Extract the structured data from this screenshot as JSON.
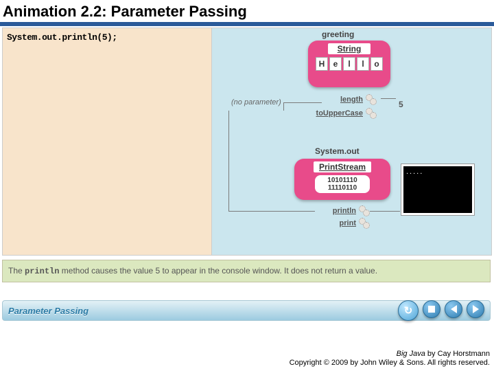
{
  "title": "Animation 2.2: Parameter Passing",
  "code_snippet": "System.out.println(5);",
  "greeting_label": "greeting",
  "string_class": "String",
  "chars": [
    "H",
    "e",
    "l",
    "l",
    "o"
  ],
  "no_param": "(no parameter)",
  "method_length": "length",
  "method_upper": "toUpperCase",
  "length_result": "5",
  "systemout_label": "System.out",
  "printstream_class": "PrintStream",
  "binary_row1": "10101110",
  "binary_row2": "11110110",
  "method_println": "println",
  "method_print": "print",
  "console_output": ".....",
  "caption_pre": "The ",
  "caption_mono": "println",
  "caption_post": " method causes the value 5 to appear in the console window. It does not return a value.",
  "bottom_title": "Parameter Passing",
  "icons": {
    "refresh": "↻",
    "stop": "stop",
    "prev": "prev",
    "next": "next"
  },
  "credit_book": "Big Java",
  "credit_author": " by Cay Horstmann",
  "credit_line2": "Copyright © 2009 by John Wiley & Sons. All rights reserved."
}
